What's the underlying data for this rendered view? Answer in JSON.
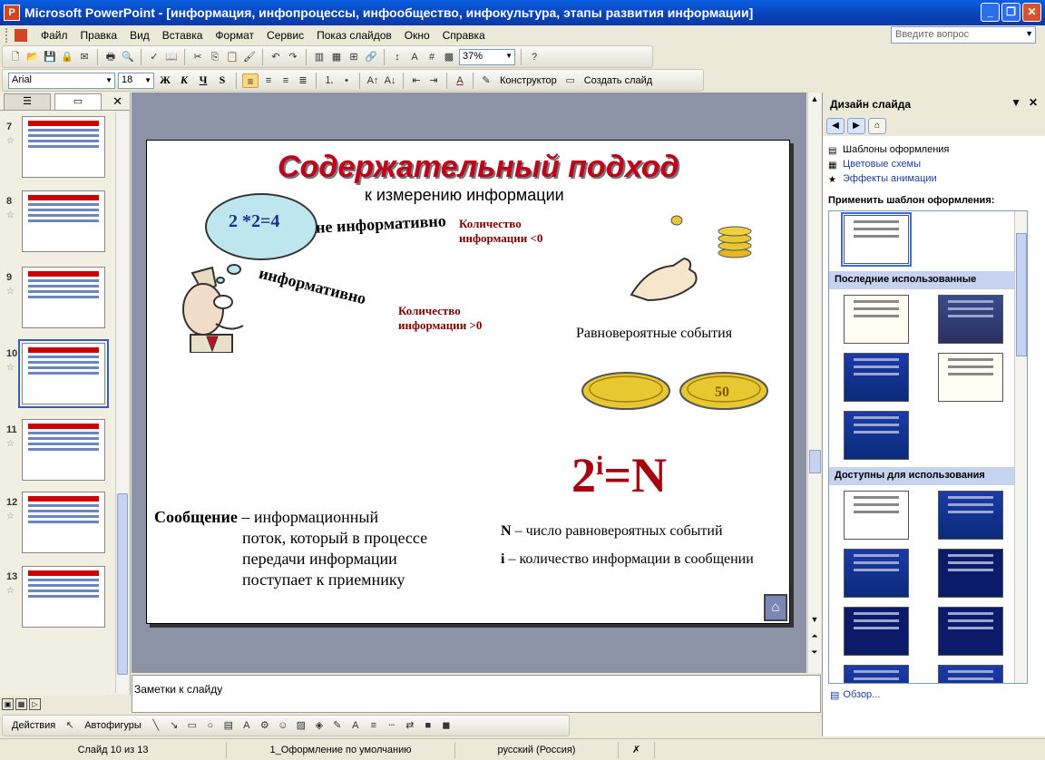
{
  "window": {
    "title": "Microsoft PowerPoint - [информация, инфопроцессы, инфообщество, инфокультура, этапы развития информации]",
    "controls": [
      "_",
      "❐",
      "✕"
    ]
  },
  "menu": {
    "items": [
      "Файл",
      "Правка",
      "Вид",
      "Вставка",
      "Формат",
      "Сервис",
      "Показ слайдов",
      "Окно",
      "Справка"
    ],
    "help_placeholder": "Введите вопрос"
  },
  "toolbar": {
    "zoom": "37%",
    "font": "Arial",
    "size": "18",
    "bold": "Ж",
    "italic": "К",
    "underline": "Ч",
    "shadow": "S",
    "designer": "Конструктор",
    "new_slide": "Создать слайд"
  },
  "thumbnails": [
    {
      "num": "7"
    },
    {
      "num": "8"
    },
    {
      "num": "9"
    },
    {
      "num": "10"
    },
    {
      "num": "11"
    },
    {
      "num": "12"
    },
    {
      "num": "13"
    }
  ],
  "slide": {
    "title": "Содержательный подход",
    "subtitle": "к измерению информации",
    "cloud": "2 *2=4",
    "not_informative": "не информативно",
    "informative": "информативно",
    "amount_lt": "Количество информации <0",
    "amount_gt": "Количество информации >0",
    "events": "Равновероятные события",
    "formula_base": "2",
    "formula_exp": "i",
    "formula_rest": "=N",
    "message_term": "Сообщение",
    "message_rest": " – информационный",
    "message_l2": "поток, который в процессе",
    "message_l3": "передачи информации",
    "message_l4": "поступает к приемнику",
    "n_term": "N",
    "n_def": " – число равновероятных событий",
    "i_term": "i",
    "i_def": " – количество информации в сообщении",
    "coin_label": "50"
  },
  "notes": {
    "placeholder": "Заметки к слайду"
  },
  "drawbar": {
    "actions": "Действия",
    "autoshapes": "Автофигуры"
  },
  "status": {
    "slide": "Слайд 10 из 13",
    "design": "1_Оформление по умолчанию",
    "language": "русский (Россия)"
  },
  "taskpane": {
    "title": "Дизайн слайда",
    "link_templates": "Шаблоны оформления",
    "link_colors": "Цветовые схемы",
    "link_animation": "Эффекты анимации",
    "apply_label": "Применить шаблон оформления:",
    "recent": "Последние использованные",
    "available": "Доступны для использования",
    "browse": "Обзор..."
  }
}
